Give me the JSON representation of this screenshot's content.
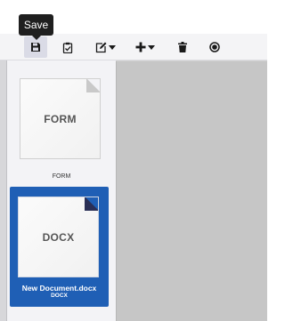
{
  "tooltip": {
    "text": "Save"
  },
  "toolbar": {
    "save": "save-icon",
    "clipboard": "clipboard-check-icon",
    "edit": "edit-dropdown-icon",
    "add": "plus-dropdown-icon",
    "delete": "trash-icon",
    "record": "record-icon"
  },
  "documents": [
    {
      "thumb_label": "FORM",
      "caption": "FORM"
    },
    {
      "thumb_label": "DOCX",
      "title": "New Document.docx",
      "subtitle": "DOCX",
      "selected": true
    }
  ],
  "colors": {
    "selected": "#1f5fb5",
    "canvas": "#c6c6c6",
    "panel": "#f3f3f6"
  }
}
